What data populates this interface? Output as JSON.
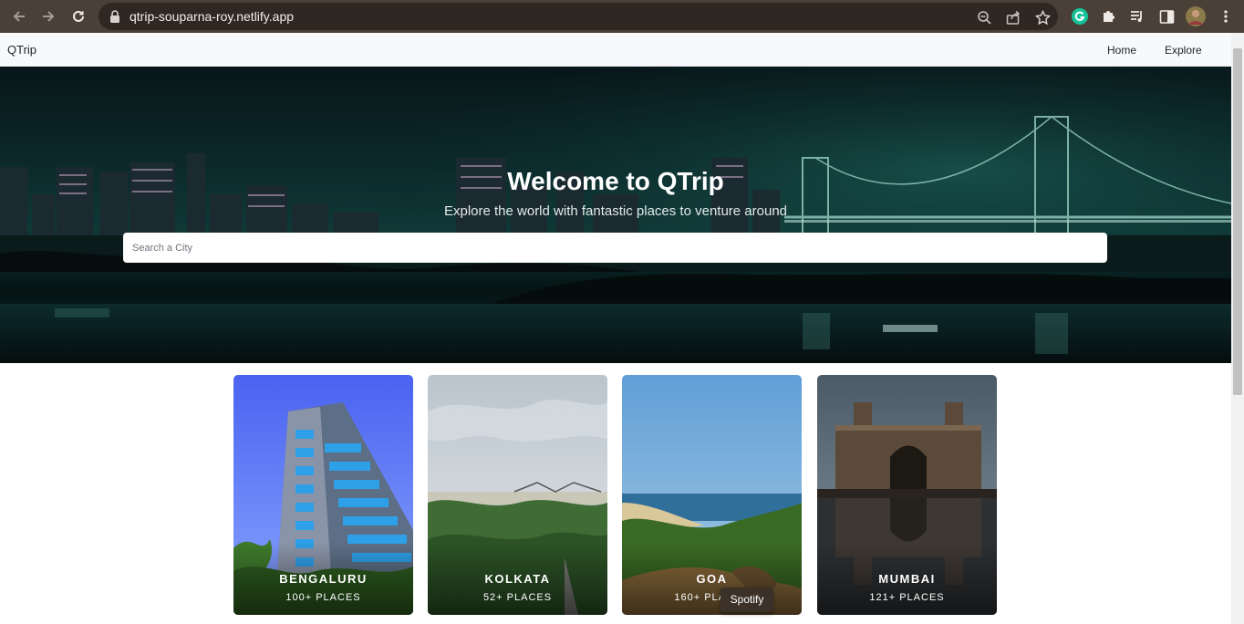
{
  "browser": {
    "url": "qtrip-souparna-roy.netlify.app",
    "icons": [
      "back-arrow-icon",
      "forward-arrow-icon",
      "reload-icon",
      "lock-icon",
      "zoom-icon",
      "share-icon",
      "bookmark-star-icon",
      "grammarly-icon",
      "extensions-puzzle-icon",
      "media-control-icon",
      "side-panel-icon",
      "profile-avatar",
      "kebab-menu-icon"
    ]
  },
  "navbar": {
    "brand": "QTrip",
    "links": [
      "Home",
      "Explore"
    ]
  },
  "hero": {
    "title": "Welcome to QTrip",
    "subtitle": "Explore the world with fantastic places to venture around",
    "search_placeholder": "Search a City"
  },
  "cities": [
    {
      "name": "BENGALURU",
      "places": "100+ PLACES"
    },
    {
      "name": "KOLKATA",
      "places": "52+ PLACES"
    },
    {
      "name": "GOA",
      "places": "160+ PLACES"
    },
    {
      "name": "MUMBAI",
      "places": "121+ PLACES"
    }
  ],
  "tooltip": "Spotify"
}
